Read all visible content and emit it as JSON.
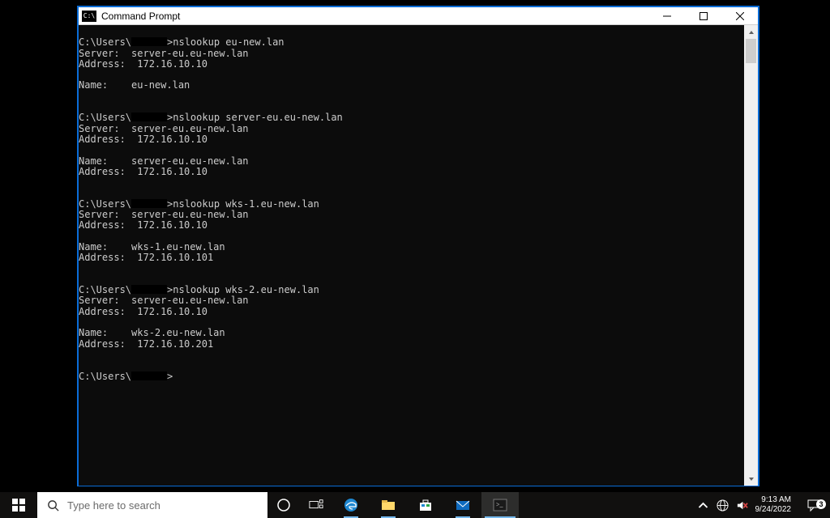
{
  "window": {
    "title": "Command Prompt",
    "icon_glyph": "C:\\"
  },
  "console": {
    "prompt_prefix": "C:\\Users\\",
    "prompt_suffix": ">",
    "blocks": [
      {
        "command": "nslookup eu-new.lan",
        "server": "server-eu.eu-new.lan",
        "server_address": "172.16.10.10",
        "name": "eu-new.lan",
        "name_address": null
      },
      {
        "command": "nslookup server-eu.eu-new.lan",
        "server": "server-eu.eu-new.lan",
        "server_address": "172.16.10.10",
        "name": "server-eu.eu-new.lan",
        "name_address": "172.16.10.10"
      },
      {
        "command": "nslookup wks-1.eu-new.lan",
        "server": "server-eu.eu-new.lan",
        "server_address": "172.16.10.10",
        "name": "wks-1.eu-new.lan",
        "name_address": "172.16.10.101"
      },
      {
        "command": "nslookup wks-2.eu-new.lan",
        "server": "server-eu.eu-new.lan",
        "server_address": "172.16.10.10",
        "name": "wks-2.eu-new.lan",
        "name_address": "172.16.10.201"
      }
    ]
  },
  "taskbar": {
    "search_placeholder": "Type here to search",
    "time": "9:13 AM",
    "date": "9/24/2022",
    "notification_count": "3"
  },
  "icon_names": {
    "start": "start-icon",
    "search": "search-icon",
    "cortana": "cortana-icon",
    "taskview": "task-view-icon",
    "edge": "edge-icon",
    "explorer": "file-explorer-icon",
    "store": "store-icon",
    "mail": "mail-icon",
    "cmd": "command-prompt-icon",
    "chevup": "chevron-up-icon",
    "network": "network-icon",
    "volume": "volume-muted-icon",
    "action": "action-center-icon",
    "minimize": "minimize-icon",
    "maximize": "maximize-icon",
    "close": "close-icon",
    "scrollup": "scroll-up-icon",
    "scrolldown": "scroll-down-icon"
  }
}
